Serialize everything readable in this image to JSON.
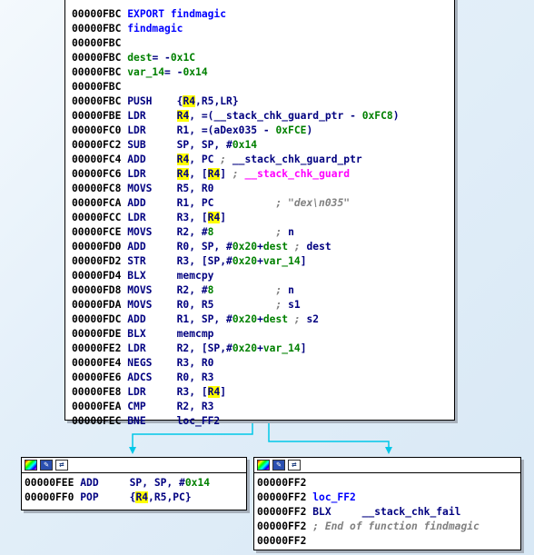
{
  "main_block": {
    "lines": [
      [
        [
          "a",
          "00000FBC "
        ],
        [
          "l",
          "EXPORT findmagic"
        ]
      ],
      [
        [
          "a",
          "00000FBC "
        ],
        [
          "l",
          "findmagic"
        ]
      ],
      [
        [
          "a",
          "00000FBC"
        ]
      ],
      [
        [
          "a",
          "00000FBC "
        ],
        [
          "v",
          "dest"
        ],
        [
          "t",
          "= -"
        ],
        [
          "n",
          "0x1C"
        ]
      ],
      [
        [
          "a",
          "00000FBC "
        ],
        [
          "v",
          "var_14"
        ],
        [
          "t",
          "= -"
        ],
        [
          "n",
          "0x14"
        ]
      ],
      [
        [
          "a",
          "00000FBC"
        ]
      ],
      [
        [
          "a",
          "00000FBC "
        ],
        [
          "t",
          "PUSH    {"
        ],
        [
          "h",
          "R4"
        ],
        [
          "t",
          ",R5,LR}"
        ]
      ],
      [
        [
          "a",
          "00000FBE "
        ],
        [
          "t",
          "LDR     "
        ],
        [
          "h",
          "R4"
        ],
        [
          "t",
          ", =(__stack_chk_guard_ptr - "
        ],
        [
          "n",
          "0xFC8"
        ],
        [
          "t",
          ")"
        ]
      ],
      [
        [
          "a",
          "00000FC0 "
        ],
        [
          "t",
          "LDR     R1, =(aDex035 - "
        ],
        [
          "n",
          "0xFCE"
        ],
        [
          "t",
          ")"
        ]
      ],
      [
        [
          "a",
          "00000FC2 "
        ],
        [
          "t",
          "SUB     SP, SP, #"
        ],
        [
          "n",
          "0x14"
        ]
      ],
      [
        [
          "a",
          "00000FC4 "
        ],
        [
          "t",
          "ADD     "
        ],
        [
          "h",
          "R4"
        ],
        [
          "t",
          ", PC "
        ],
        [
          "c",
          "; "
        ],
        [
          "t",
          "__stack_chk_guard_ptr"
        ]
      ],
      [
        [
          "a",
          "00000FC6 "
        ],
        [
          "t",
          "LDR     "
        ],
        [
          "h",
          "R4"
        ],
        [
          "t",
          ", ["
        ],
        [
          "h",
          "R4"
        ],
        [
          "t",
          "] "
        ],
        [
          "c",
          "; "
        ],
        [
          "s",
          "__stack_chk_guard"
        ]
      ],
      [
        [
          "a",
          "00000FC8 "
        ],
        [
          "t",
          "MOVS    R5, R0"
        ]
      ],
      [
        [
          "a",
          "00000FCA "
        ],
        [
          "t",
          "ADD     R1, PC          "
        ],
        [
          "c",
          "; \"dex\\n035\""
        ]
      ],
      [
        [
          "a",
          "00000FCC "
        ],
        [
          "t",
          "LDR     R3, ["
        ],
        [
          "h",
          "R4"
        ],
        [
          "t",
          "]"
        ]
      ],
      [
        [
          "a",
          "00000FCE "
        ],
        [
          "t",
          "MOVS    R2, #"
        ],
        [
          "n",
          "8"
        ],
        [
          "t",
          "          "
        ],
        [
          "c",
          "; "
        ],
        [
          "t",
          "n"
        ]
      ],
      [
        [
          "a",
          "00000FD0 "
        ],
        [
          "t",
          "ADD     R0, SP, #"
        ],
        [
          "n",
          "0x20"
        ],
        [
          "t",
          "+"
        ],
        [
          "v",
          "dest"
        ],
        [
          "c",
          " ; "
        ],
        [
          "t",
          "dest"
        ]
      ],
      [
        [
          "a",
          "00000FD2 "
        ],
        [
          "t",
          "STR     R3, [SP,#"
        ],
        [
          "n",
          "0x20"
        ],
        [
          "t",
          "+"
        ],
        [
          "v",
          "var_14"
        ],
        [
          "t",
          "]"
        ]
      ],
      [
        [
          "a",
          "00000FD4 "
        ],
        [
          "t",
          "BLX     memcpy"
        ]
      ],
      [
        [
          "a",
          "00000FD8 "
        ],
        [
          "t",
          "MOVS    R2, #"
        ],
        [
          "n",
          "8"
        ],
        [
          "t",
          "          "
        ],
        [
          "c",
          "; "
        ],
        [
          "t",
          "n"
        ]
      ],
      [
        [
          "a",
          "00000FDA "
        ],
        [
          "t",
          "MOVS    R0, R5          "
        ],
        [
          "c",
          "; "
        ],
        [
          "t",
          "s1"
        ]
      ],
      [
        [
          "a",
          "00000FDC "
        ],
        [
          "t",
          "ADD     R1, SP, #"
        ],
        [
          "n",
          "0x20"
        ],
        [
          "t",
          "+"
        ],
        [
          "v",
          "dest"
        ],
        [
          "c",
          " ; "
        ],
        [
          "t",
          "s2"
        ]
      ],
      [
        [
          "a",
          "00000FDE "
        ],
        [
          "t",
          "BLX     memcmp"
        ]
      ],
      [
        [
          "a",
          "00000FE2 "
        ],
        [
          "t",
          "LDR     R2, [SP,#"
        ],
        [
          "n",
          "0x20"
        ],
        [
          "t",
          "+"
        ],
        [
          "v",
          "var_14"
        ],
        [
          "t",
          "]"
        ]
      ],
      [
        [
          "a",
          "00000FE4 "
        ],
        [
          "t",
          "NEGS    R3, R0"
        ]
      ],
      [
        [
          "a",
          "00000FE6 "
        ],
        [
          "t",
          "ADCS    R0, R3"
        ]
      ],
      [
        [
          "a",
          "00000FE8 "
        ],
        [
          "t",
          "LDR     R3, ["
        ],
        [
          "h",
          "R4"
        ],
        [
          "t",
          "]"
        ]
      ],
      [
        [
          "a",
          "00000FEA "
        ],
        [
          "t",
          "CMP     R2, R3"
        ]
      ],
      [
        [
          "a",
          "00000FEC "
        ],
        [
          "t",
          "BNE     loc_FF2"
        ]
      ]
    ]
  },
  "left_block": {
    "lines": [
      [
        [
          "a",
          "00000FEE "
        ],
        [
          "t",
          "ADD     SP, SP, #"
        ],
        [
          "n",
          "0x14"
        ]
      ],
      [
        [
          "a",
          "00000FF0 "
        ],
        [
          "t",
          "POP     {"
        ],
        [
          "h",
          "R4"
        ],
        [
          "t",
          ",R5,PC}"
        ]
      ]
    ]
  },
  "right_block": {
    "lines": [
      [
        [
          "a",
          "00000FF2"
        ]
      ],
      [
        [
          "a",
          "00000FF2 "
        ],
        [
          "l",
          "loc_FF2"
        ]
      ],
      [
        [
          "a",
          "00000FF2 "
        ],
        [
          "t",
          "BLX     __stack_chk_fail"
        ]
      ],
      [
        [
          "a",
          "00000FF2 "
        ],
        [
          "c",
          "; End of function findmagic"
        ]
      ],
      [
        [
          "a",
          "00000FF2"
        ]
      ]
    ]
  },
  "colors": {
    "arrow": "#00c8e8",
    "highlight": "#ffff00",
    "address": "#000000",
    "mnemonic": "#000080",
    "label": "#0000ff",
    "number": "#008000",
    "comment": "#808080",
    "symbol": "#ff00ff"
  },
  "icons": [
    "color-palette-icon",
    "edit-icon",
    "graph-icon"
  ]
}
